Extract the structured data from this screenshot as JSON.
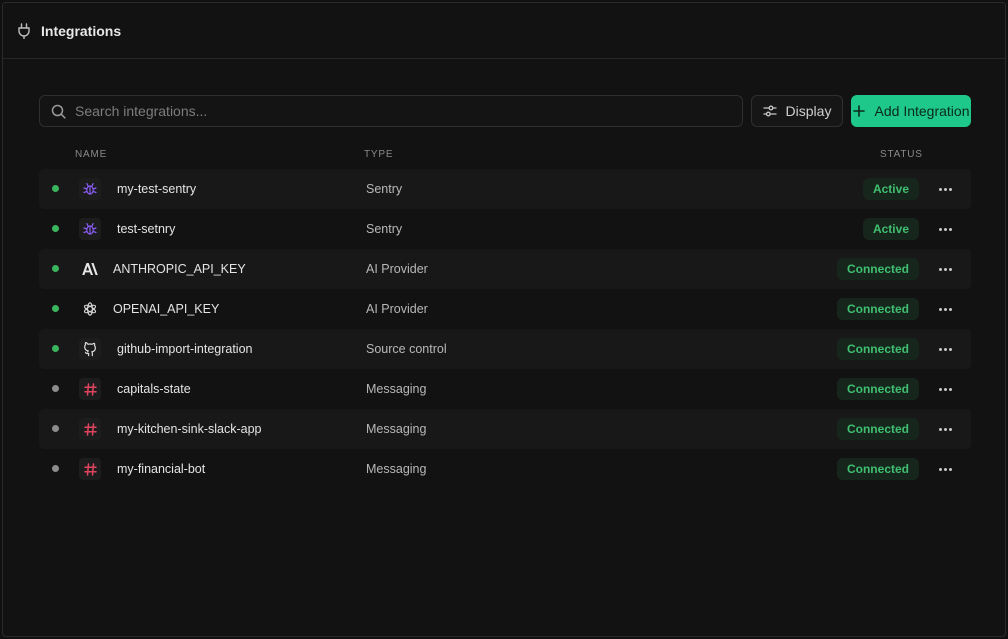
{
  "header": {
    "title": "Integrations",
    "icon": "plug-icon"
  },
  "toolbar": {
    "search_placeholder": "Search integrations...",
    "display_label": "Display",
    "add_label": "Add Integration"
  },
  "columns": {
    "name": "NAME",
    "type": "TYPE",
    "status": "STATUS"
  },
  "colors": {
    "accent": "#1ec78a",
    "status_green": "#3fbf6f",
    "dot_active": "#3ab55e",
    "dot_idle": "#8c8c8c",
    "sentry_purple": "#8b5cf6",
    "slack_red": "#e0455f"
  },
  "rows": [
    {
      "name": "my-test-sentry",
      "type": "Sentry",
      "status": "Active",
      "icon": "bug-icon",
      "dot": "active"
    },
    {
      "name": "test-setnry",
      "type": "Sentry",
      "status": "Active",
      "icon": "bug-icon",
      "dot": "active"
    },
    {
      "name": "ANTHROPIC_API_KEY",
      "type": "AI Provider",
      "status": "Connected",
      "icon": "anthropic-icon",
      "dot": "active"
    },
    {
      "name": "OPENAI_API_KEY",
      "type": "AI Provider",
      "status": "Connected",
      "icon": "openai-icon",
      "dot": "active"
    },
    {
      "name": "github-import-integration",
      "type": "Source control",
      "status": "Connected",
      "icon": "github-icon",
      "dot": "active"
    },
    {
      "name": "capitals-state",
      "type": "Messaging",
      "status": "Connected",
      "icon": "hash-icon",
      "dot": "idle"
    },
    {
      "name": "my-kitchen-sink-slack-app",
      "type": "Messaging",
      "status": "Connected",
      "icon": "hash-icon",
      "dot": "idle"
    },
    {
      "name": "my-financial-bot",
      "type": "Messaging",
      "status": "Connected",
      "icon": "hash-icon",
      "dot": "idle"
    }
  ]
}
